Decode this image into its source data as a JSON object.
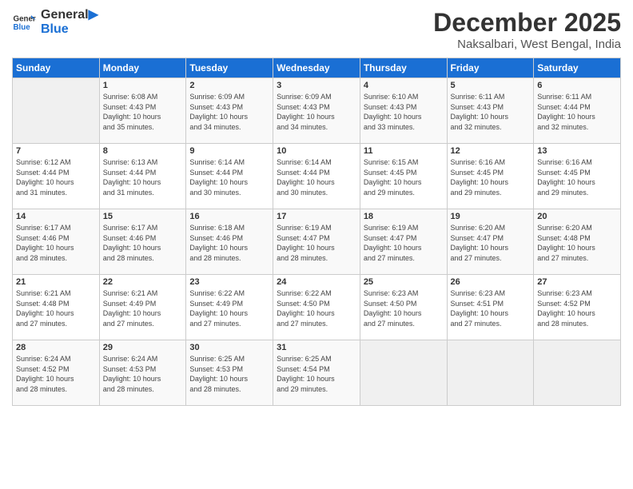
{
  "header": {
    "logo_line1": "General",
    "logo_line2": "Blue",
    "month_title": "December 2025",
    "location": "Naksalbari, West Bengal, India"
  },
  "weekdays": [
    "Sunday",
    "Monday",
    "Tuesday",
    "Wednesday",
    "Thursday",
    "Friday",
    "Saturday"
  ],
  "weeks": [
    [
      {
        "day": "",
        "info": ""
      },
      {
        "day": "1",
        "info": "Sunrise: 6:08 AM\nSunset: 4:43 PM\nDaylight: 10 hours\nand 35 minutes."
      },
      {
        "day": "2",
        "info": "Sunrise: 6:09 AM\nSunset: 4:43 PM\nDaylight: 10 hours\nand 34 minutes."
      },
      {
        "day": "3",
        "info": "Sunrise: 6:09 AM\nSunset: 4:43 PM\nDaylight: 10 hours\nand 34 minutes."
      },
      {
        "day": "4",
        "info": "Sunrise: 6:10 AM\nSunset: 4:43 PM\nDaylight: 10 hours\nand 33 minutes."
      },
      {
        "day": "5",
        "info": "Sunrise: 6:11 AM\nSunset: 4:43 PM\nDaylight: 10 hours\nand 32 minutes."
      },
      {
        "day": "6",
        "info": "Sunrise: 6:11 AM\nSunset: 4:44 PM\nDaylight: 10 hours\nand 32 minutes."
      }
    ],
    [
      {
        "day": "7",
        "info": "Sunrise: 6:12 AM\nSunset: 4:44 PM\nDaylight: 10 hours\nand 31 minutes."
      },
      {
        "day": "8",
        "info": "Sunrise: 6:13 AM\nSunset: 4:44 PM\nDaylight: 10 hours\nand 31 minutes."
      },
      {
        "day": "9",
        "info": "Sunrise: 6:14 AM\nSunset: 4:44 PM\nDaylight: 10 hours\nand 30 minutes."
      },
      {
        "day": "10",
        "info": "Sunrise: 6:14 AM\nSunset: 4:44 PM\nDaylight: 10 hours\nand 30 minutes."
      },
      {
        "day": "11",
        "info": "Sunrise: 6:15 AM\nSunset: 4:45 PM\nDaylight: 10 hours\nand 29 minutes."
      },
      {
        "day": "12",
        "info": "Sunrise: 6:16 AM\nSunset: 4:45 PM\nDaylight: 10 hours\nand 29 minutes."
      },
      {
        "day": "13",
        "info": "Sunrise: 6:16 AM\nSunset: 4:45 PM\nDaylight: 10 hours\nand 29 minutes."
      }
    ],
    [
      {
        "day": "14",
        "info": "Sunrise: 6:17 AM\nSunset: 4:46 PM\nDaylight: 10 hours\nand 28 minutes."
      },
      {
        "day": "15",
        "info": "Sunrise: 6:17 AM\nSunset: 4:46 PM\nDaylight: 10 hours\nand 28 minutes."
      },
      {
        "day": "16",
        "info": "Sunrise: 6:18 AM\nSunset: 4:46 PM\nDaylight: 10 hours\nand 28 minutes."
      },
      {
        "day": "17",
        "info": "Sunrise: 6:19 AM\nSunset: 4:47 PM\nDaylight: 10 hours\nand 28 minutes."
      },
      {
        "day": "18",
        "info": "Sunrise: 6:19 AM\nSunset: 4:47 PM\nDaylight: 10 hours\nand 27 minutes."
      },
      {
        "day": "19",
        "info": "Sunrise: 6:20 AM\nSunset: 4:47 PM\nDaylight: 10 hours\nand 27 minutes."
      },
      {
        "day": "20",
        "info": "Sunrise: 6:20 AM\nSunset: 4:48 PM\nDaylight: 10 hours\nand 27 minutes."
      }
    ],
    [
      {
        "day": "21",
        "info": "Sunrise: 6:21 AM\nSunset: 4:48 PM\nDaylight: 10 hours\nand 27 minutes."
      },
      {
        "day": "22",
        "info": "Sunrise: 6:21 AM\nSunset: 4:49 PM\nDaylight: 10 hours\nand 27 minutes."
      },
      {
        "day": "23",
        "info": "Sunrise: 6:22 AM\nSunset: 4:49 PM\nDaylight: 10 hours\nand 27 minutes."
      },
      {
        "day": "24",
        "info": "Sunrise: 6:22 AM\nSunset: 4:50 PM\nDaylight: 10 hours\nand 27 minutes."
      },
      {
        "day": "25",
        "info": "Sunrise: 6:23 AM\nSunset: 4:50 PM\nDaylight: 10 hours\nand 27 minutes."
      },
      {
        "day": "26",
        "info": "Sunrise: 6:23 AM\nSunset: 4:51 PM\nDaylight: 10 hours\nand 27 minutes."
      },
      {
        "day": "27",
        "info": "Sunrise: 6:23 AM\nSunset: 4:52 PM\nDaylight: 10 hours\nand 28 minutes."
      }
    ],
    [
      {
        "day": "28",
        "info": "Sunrise: 6:24 AM\nSunset: 4:52 PM\nDaylight: 10 hours\nand 28 minutes."
      },
      {
        "day": "29",
        "info": "Sunrise: 6:24 AM\nSunset: 4:53 PM\nDaylight: 10 hours\nand 28 minutes."
      },
      {
        "day": "30",
        "info": "Sunrise: 6:25 AM\nSunset: 4:53 PM\nDaylight: 10 hours\nand 28 minutes."
      },
      {
        "day": "31",
        "info": "Sunrise: 6:25 AM\nSunset: 4:54 PM\nDaylight: 10 hours\nand 29 minutes."
      },
      {
        "day": "",
        "info": ""
      },
      {
        "day": "",
        "info": ""
      },
      {
        "day": "",
        "info": ""
      }
    ]
  ]
}
